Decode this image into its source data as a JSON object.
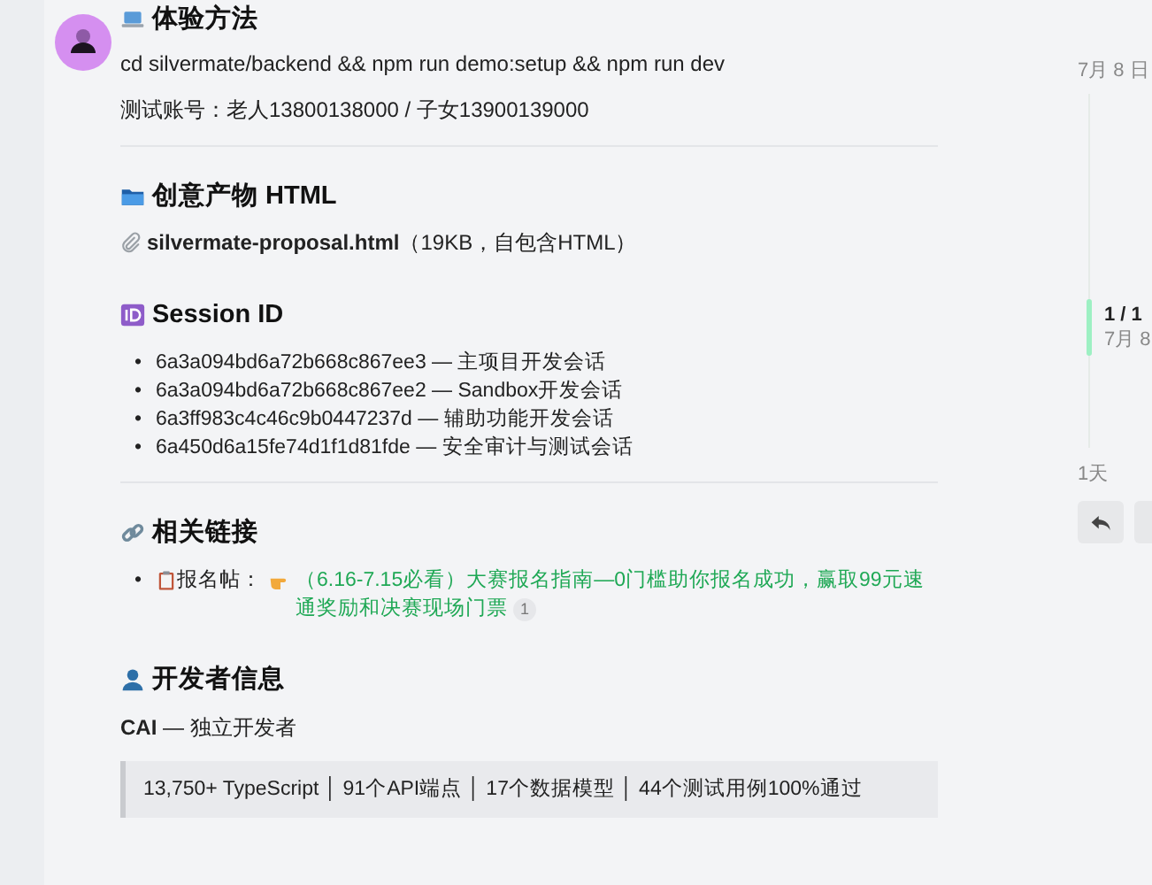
{
  "post": {
    "setup": {
      "title": "体验方法",
      "command": "cd silvermate/backend && npm run demo:setup && npm run dev",
      "accounts": "测试账号：老人13800138000 / 子女13900139000"
    },
    "artifact": {
      "title": "创意产物 HTML",
      "file": "**silvermate-proposal.html**（19KB，自包含HTML）"
    },
    "sessions": {
      "title": "Session ID",
      "bullet": "•",
      "items": [
        "6a3a094bd6a72b668c867ee3 — 主项目开发会话",
        "6a3a094bd6a72b668c867ee2 — Sandbox开发会话",
        "6a3ff983c4c46c9b0447237d — 辅助功能开发会话",
        "6a450d6a15fe74d1f1d81fde — 安全审计与测试会话"
      ]
    },
    "links": {
      "title": "相关链接",
      "bullet": "•",
      "items": [
        {
          "label": "报名帖：",
          "link": "（6.16-7.15必看）大赛报名指南—0门槛助你报名成功，赢取99元速通奖励和决赛现场门票",
          "clicks": "1"
        }
      ]
    },
    "developer": {
      "title": "开发者信息",
      "byline": "**CAI** — 独立开发者",
      "stats": "13,750+ TypeScript │ 91个API端点 │ 17个数据模型 │ 44个测试用例100%通过"
    }
  },
  "timeline": {
    "start": "7月 8 日",
    "position": "1 / 1",
    "date": "7月 8",
    "ago": "1天"
  }
}
